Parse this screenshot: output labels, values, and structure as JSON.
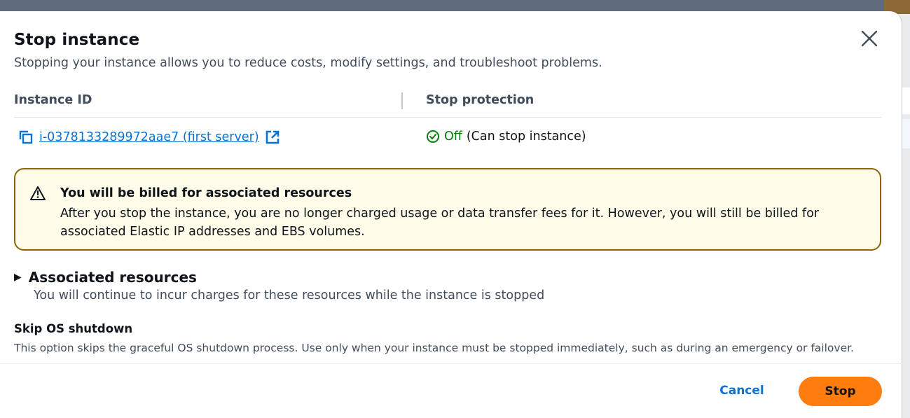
{
  "modal": {
    "title": "Stop instance",
    "description": "Stopping your instance allows you to reduce costs, modify settings, and troubleshoot problems.",
    "close_icon": "close-icon"
  },
  "details": {
    "col_instance_id": "Instance ID",
    "col_stop_protection": "Stop protection",
    "instance_link": "i-0378133289972aae7 (first server)",
    "protection_status": "Off",
    "protection_note": "(Can stop instance)",
    "status_color": "#037f0c"
  },
  "alert": {
    "title": "You will be billed for associated resources",
    "body": "After you stop the instance, you are no longer charged usage or data transfer fees for it. However, you will still be billed for associated Elastic IP addresses and EBS volumes.",
    "border_color": "#8d6605",
    "background": "#fffce9"
  },
  "associated": {
    "title": "Associated resources",
    "description": "You will continue to incur charges for these resources while the instance is stopped"
  },
  "skip_os": {
    "title": "Skip OS shutdown",
    "description": "This option skips the graceful OS shutdown process. Use only when your instance must be stopped immediately, such as during an emergency or failover."
  },
  "footer": {
    "cancel_label": "Cancel",
    "stop_label": "Stop",
    "accent": "#ff7c0d"
  }
}
